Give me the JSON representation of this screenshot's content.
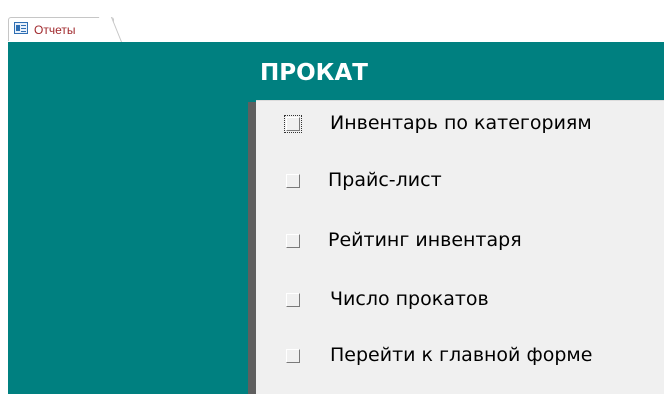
{
  "tab": {
    "label": "Отчеты",
    "icon": "report-icon"
  },
  "form": {
    "title": "ПРОКАТ",
    "background": "#008080",
    "menu": [
      {
        "label": "Инвентарь по категориям",
        "focused": true
      },
      {
        "label": "Прайс-лист",
        "focused": false
      },
      {
        "label": "Рейтинг инвентаря",
        "focused": false
      },
      {
        "label": "Число прокатов",
        "focused": false
      },
      {
        "label": "Перейти к главной форме",
        "focused": false
      }
    ]
  }
}
